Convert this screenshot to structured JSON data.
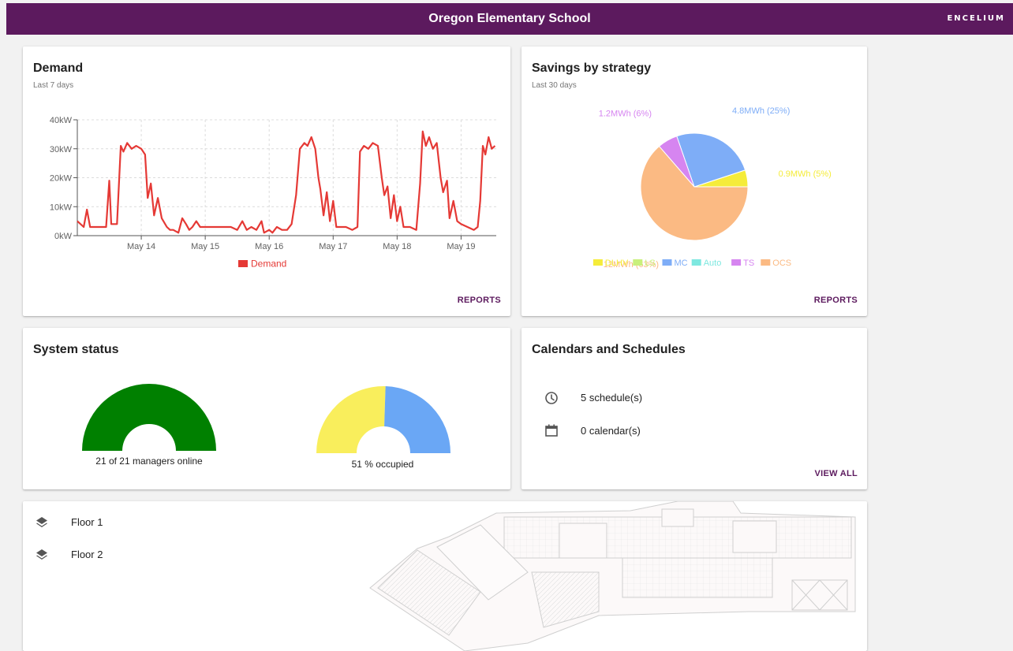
{
  "header": {
    "title": "Oregon Elementary School",
    "brand": "ENCELIUM"
  },
  "demand": {
    "title": "Demand",
    "subtitle": "Last 7 days",
    "action": "REPORTS",
    "chart_data": {
      "type": "line",
      "series": [
        {
          "name": "Demand",
          "color": "#e53935",
          "unit": "kW",
          "points": [
            [
              0,
              5
            ],
            [
              0.1,
              3
            ],
            [
              0.15,
              9
            ],
            [
              0.2,
              3
            ],
            [
              0.45,
              3
            ],
            [
              0.5,
              19
            ],
            [
              0.53,
              4
            ],
            [
              0.62,
              4
            ],
            [
              0.68,
              31
            ],
            [
              0.72,
              29
            ],
            [
              0.78,
              32
            ],
            [
              0.85,
              30
            ],
            [
              0.92,
              31
            ],
            [
              1.0,
              30
            ],
            [
              1.06,
              28
            ],
            [
              1.1,
              13
            ],
            [
              1.15,
              18
            ],
            [
              1.2,
              7
            ],
            [
              1.26,
              13
            ],
            [
              1.32,
              6
            ],
            [
              1.4,
              3
            ],
            [
              1.45,
              2
            ],
            [
              1.5,
              2
            ],
            [
              1.58,
              1
            ],
            [
              1.64,
              6
            ],
            [
              1.7,
              4
            ],
            [
              1.75,
              2
            ],
            [
              1.8,
              3
            ],
            [
              1.86,
              5
            ],
            [
              1.92,
              3
            ],
            [
              2.0,
              3
            ],
            [
              2.2,
              3
            ],
            [
              2.4,
              3
            ],
            [
              2.5,
              2
            ],
            [
              2.58,
              5
            ],
            [
              2.65,
              2
            ],
            [
              2.72,
              3
            ],
            [
              2.8,
              2
            ],
            [
              2.88,
              5
            ],
            [
              2.92,
              1
            ],
            [
              3.0,
              2
            ],
            [
              3.05,
              1
            ],
            [
              3.12,
              3
            ],
            [
              3.2,
              2
            ],
            [
              3.28,
              2
            ],
            [
              3.35,
              4
            ],
            [
              3.42,
              14
            ],
            [
              3.48,
              30
            ],
            [
              3.55,
              32
            ],
            [
              3.6,
              31
            ],
            [
              3.66,
              34
            ],
            [
              3.72,
              30
            ],
            [
              3.77,
              20
            ],
            [
              3.8,
              16
            ],
            [
              3.85,
              7
            ],
            [
              3.9,
              15
            ],
            [
              3.95,
              5
            ],
            [
              4.0,
              12
            ],
            [
              4.05,
              3
            ],
            [
              4.2,
              3
            ],
            [
              4.3,
              2
            ],
            [
              4.38,
              3
            ],
            [
              4.42,
              29
            ],
            [
              4.48,
              31
            ],
            [
              4.55,
              30
            ],
            [
              4.62,
              32
            ],
            [
              4.7,
              31
            ],
            [
              4.76,
              20
            ],
            [
              4.8,
              14
            ],
            [
              4.85,
              17
            ],
            [
              4.9,
              6
            ],
            [
              4.95,
              14
            ],
            [
              5.0,
              5
            ],
            [
              5.05,
              10
            ],
            [
              5.1,
              3
            ],
            [
              5.2,
              3
            ],
            [
              5.3,
              2
            ],
            [
              5.36,
              18
            ],
            [
              5.4,
              36
            ],
            [
              5.45,
              31
            ],
            [
              5.5,
              34
            ],
            [
              5.56,
              30
            ],
            [
              5.62,
              32
            ],
            [
              5.68,
              20
            ],
            [
              5.72,
              15
            ],
            [
              5.78,
              19
            ],
            [
              5.82,
              6
            ],
            [
              5.88,
              12
            ],
            [
              5.94,
              5
            ],
            [
              6.0,
              4
            ],
            [
              6.1,
              3
            ],
            [
              6.2,
              2
            ],
            [
              6.26,
              3
            ],
            [
              6.3,
              12
            ],
            [
              6.34,
              31
            ],
            [
              6.38,
              28
            ],
            [
              6.43,
              34
            ],
            [
              6.48,
              30
            ],
            [
              6.53,
              31
            ]
          ]
        }
      ],
      "x_ticks": [
        "May 14",
        "May 15",
        "May 16",
        "May 17",
        "May 18",
        "May 19"
      ],
      "y_ticks": [
        "0kW",
        "10kW",
        "20kW",
        "30kW",
        "40kW"
      ],
      "ylim": [
        0,
        40
      ],
      "legend": {
        "label": "Demand",
        "placement": "bottom"
      },
      "grid": true
    }
  },
  "savings": {
    "title": "Savings by strategy",
    "subtitle": "Last 30 days",
    "action": "REPORTS",
    "chart_data": {
      "type": "pie",
      "slices": [
        {
          "name": "DLHV",
          "percent": 5,
          "label": "0.9MWh (5%)",
          "color": "#f5ec3a"
        },
        {
          "name": "MC",
          "percent": 25,
          "label": "4.8MWh (25%)",
          "color": "#7eadf7"
        },
        {
          "name": "TS",
          "percent": 6,
          "label": "1.2MWh (6%)",
          "color": "#d685f0"
        },
        {
          "name": "OCS",
          "percent": 63,
          "label": "12MWh (63%)",
          "color": "#fbba83"
        }
      ],
      "legend": [
        {
          "name": "DLHV",
          "color": "#f5ec3a"
        },
        {
          "name": "LS",
          "color": "#c9f07c"
        },
        {
          "name": "MC",
          "color": "#7eadf7"
        },
        {
          "name": "Auto",
          "color": "#7ee8e0"
        },
        {
          "name": "TS",
          "color": "#d685f0"
        },
        {
          "name": "OCS",
          "color": "#fbba83"
        }
      ]
    }
  },
  "system": {
    "title": "System status",
    "managers": {
      "online": 21,
      "total": 21,
      "label": "21 of 21 managers online",
      "color": "#008000"
    },
    "occupancy": {
      "percent": 51,
      "label": "51 % occupied",
      "occupied_color": "#f9ee5c",
      "vacant_color": "#6aa7f5"
    }
  },
  "calendars": {
    "title": "Calendars and Schedules",
    "items": [
      {
        "icon": "clock-icon",
        "label": "5 schedule(s)"
      },
      {
        "icon": "calendar-icon",
        "label": "0 calendar(s)"
      }
    ],
    "action": "VIEW ALL"
  },
  "floors": {
    "items": [
      {
        "icon": "layers-icon",
        "label": "Floor 1"
      },
      {
        "icon": "layers-icon",
        "label": "Floor 2"
      }
    ]
  }
}
